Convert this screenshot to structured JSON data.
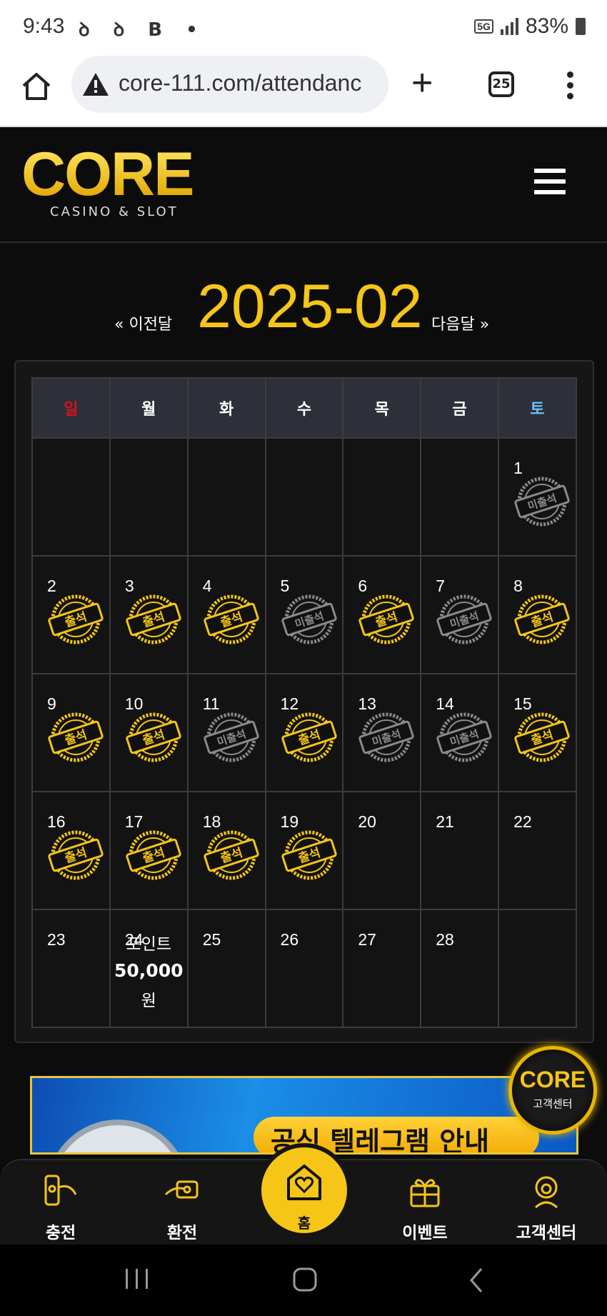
{
  "status_bar": {
    "time": "9:43",
    "notification_glyphs": "ꝺ ꝺ B •",
    "network": "5G",
    "battery": "83%"
  },
  "browser": {
    "url": "core-111.com/attendanc",
    "tab_count": "25"
  },
  "site": {
    "logo_text": "CORE",
    "logo_subtitle": "CASINO & SLOT"
  },
  "calendar": {
    "prev_label": "« 이전달",
    "month": "2025-02",
    "next_label": "다음달 »",
    "weekdays": [
      "일",
      "월",
      "화",
      "수",
      "목",
      "금",
      "토"
    ],
    "stamp_attended": "출석",
    "stamp_missed": "미출석",
    "weeks": [
      [
        {
          "day": "",
          "status": ""
        },
        {
          "day": "",
          "status": ""
        },
        {
          "day": "",
          "status": ""
        },
        {
          "day": "",
          "status": ""
        },
        {
          "day": "",
          "status": ""
        },
        {
          "day": "",
          "status": ""
        },
        {
          "day": "1",
          "status": "missed"
        }
      ],
      [
        {
          "day": "2",
          "status": "attended"
        },
        {
          "day": "3",
          "status": "attended"
        },
        {
          "day": "4",
          "status": "attended"
        },
        {
          "day": "5",
          "status": "missed"
        },
        {
          "day": "6",
          "status": "attended"
        },
        {
          "day": "7",
          "status": "missed"
        },
        {
          "day": "8",
          "status": "attended"
        }
      ],
      [
        {
          "day": "9",
          "status": "attended"
        },
        {
          "day": "10",
          "status": "attended"
        },
        {
          "day": "11",
          "status": "missed"
        },
        {
          "day": "12",
          "status": "attended"
        },
        {
          "day": "13",
          "status": "missed"
        },
        {
          "day": "14",
          "status": "missed"
        },
        {
          "day": "15",
          "status": "attended"
        }
      ],
      [
        {
          "day": "16",
          "status": "attended"
        },
        {
          "day": "17",
          "status": "attended"
        },
        {
          "day": "18",
          "status": "attended"
        },
        {
          "day": "19",
          "status": "attended"
        },
        {
          "day": "20",
          "status": ""
        },
        {
          "day": "21",
          "status": ""
        },
        {
          "day": "22",
          "status": ""
        }
      ],
      [
        {
          "day": "23",
          "status": ""
        },
        {
          "day": "24",
          "status": "",
          "reward_label": "포인트",
          "reward_amount": "50,000",
          "reward_unit": "원"
        },
        {
          "day": "25",
          "status": ""
        },
        {
          "day": "26",
          "status": ""
        },
        {
          "day": "27",
          "status": ""
        },
        {
          "day": "28",
          "status": ""
        },
        {
          "day": "",
          "status": ""
        }
      ]
    ]
  },
  "banner": {
    "text": "공식 텔레그램 안내"
  },
  "floating_cs": {
    "logo": "CORE",
    "label": "고객센터"
  },
  "bottom_nav": {
    "items": [
      {
        "label": "충전",
        "icon": "deposit-icon"
      },
      {
        "label": "환전",
        "icon": "exchange-icon"
      },
      {
        "label": "홈",
        "icon": "home-heart-icon"
      },
      {
        "label": "이벤트",
        "icon": "gift-icon"
      },
      {
        "label": "고객센터",
        "icon": "support-icon"
      }
    ]
  },
  "colors": {
    "accent": "#f5c518",
    "sunday": "#d2141c",
    "saturday": "#6ac3f5",
    "missed": "#8a8a8a"
  }
}
